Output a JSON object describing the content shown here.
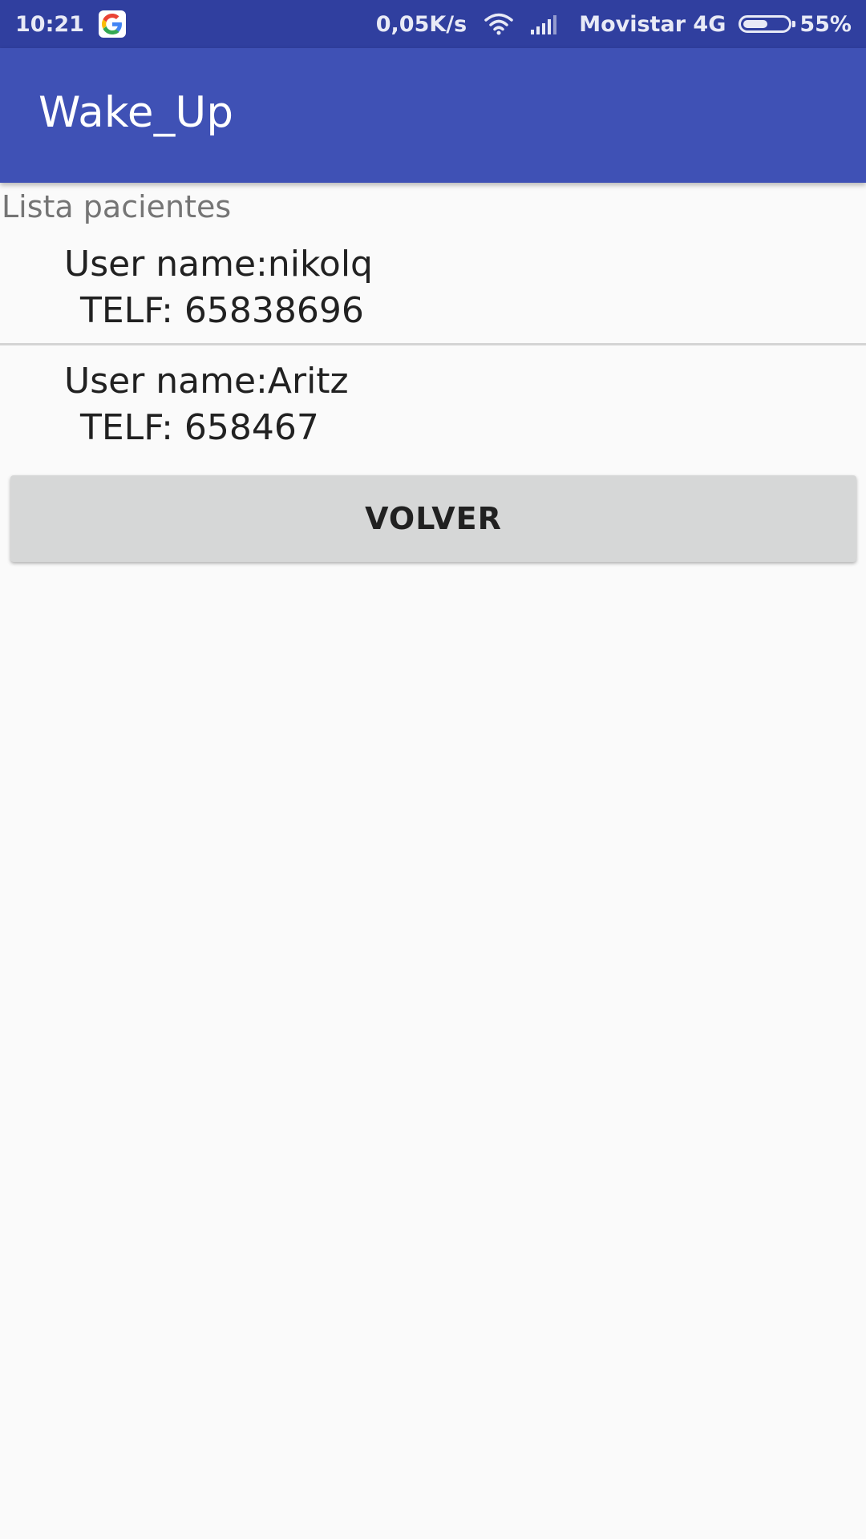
{
  "status_bar": {
    "time": "10:21",
    "network_speed": "0,05K/s",
    "carrier": "Movistar 4G",
    "battery": "55%",
    "battery_level": 0.55,
    "icons": [
      "google-icon",
      "wifi-icon",
      "signal-icon",
      "battery-icon"
    ]
  },
  "app_bar": {
    "title": "Wake_Up",
    "color": "#3f51b5",
    "status_color": "#303f9f"
  },
  "content": {
    "caption": "Lista pacientes",
    "patients": [
      {
        "name": "User name:nikolq",
        "phone": "TELF: 65838696"
      },
      {
        "name": "User name:Aritz",
        "phone": "TELF: 658467"
      }
    ],
    "back_button_label": "VOLVER"
  }
}
